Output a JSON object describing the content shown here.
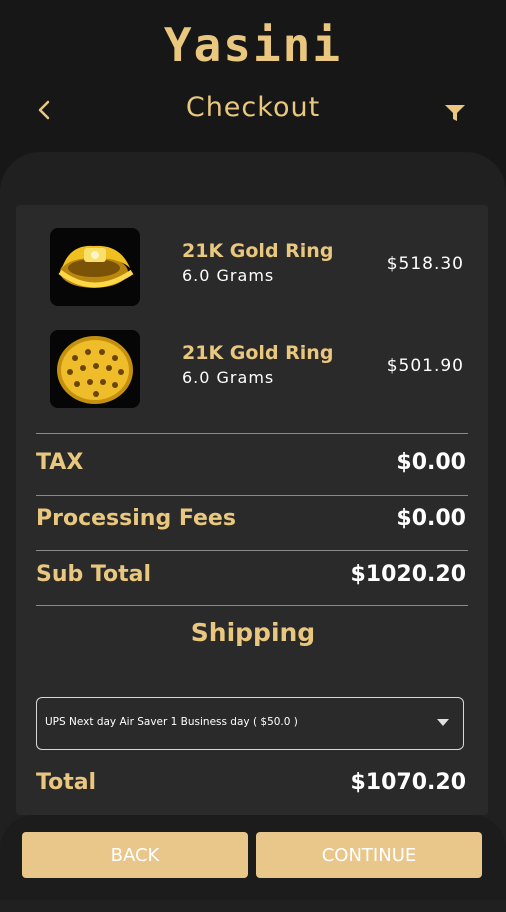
{
  "brand": {
    "logo_text": "Yasini"
  },
  "header": {
    "title": "Checkout",
    "back_icon": "back-arrow-icon",
    "filter_icon": "filter-icon"
  },
  "items": [
    {
      "name": "21K Gold Ring",
      "weight": "6.0 Grams",
      "price": "$518.30"
    },
    {
      "name": "21K Gold Ring",
      "weight": "6.0 Grams",
      "price": "$501.90"
    }
  ],
  "summary": {
    "tax_label": "TAX",
    "tax_value": "$0.00",
    "fees_label": "Processing Fees",
    "fees_value": "$0.00",
    "subtotal_label": "Sub Total",
    "subtotal_value": "$1020.20"
  },
  "shipping": {
    "title": "Shipping",
    "selected_option": "UPS Next day Air Saver 1 Business day ( $50.0 )"
  },
  "total": {
    "label": "Total",
    "value": "$1070.20"
  },
  "buttons": {
    "back": "BACK",
    "continue": "CONTINUE"
  },
  "colors": {
    "gold": "#e9c77e",
    "background": "#171717",
    "button": "#e9c78a"
  }
}
